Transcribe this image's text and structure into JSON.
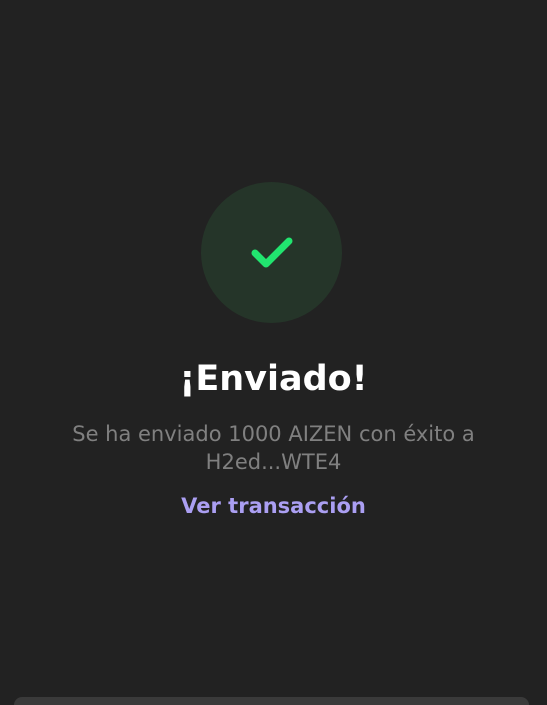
{
  "status": {
    "title": "¡Enviado!",
    "message_line1": "Se ha enviado 1000 AIZEN con éxito a",
    "message_line2": "H2ed...WTE4",
    "link_label": "Ver transacción",
    "icon": "check-icon"
  },
  "colors": {
    "background": "#222222",
    "success_circle": "#253529",
    "check": "#21e56f",
    "link": "#ab9ff2",
    "message": "#808080"
  }
}
